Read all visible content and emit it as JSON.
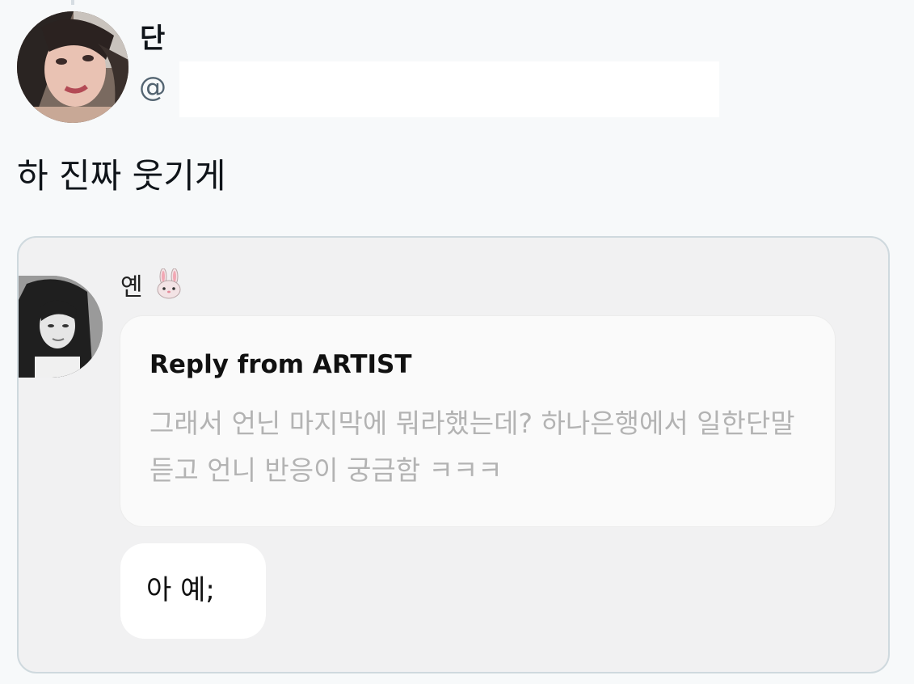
{
  "tweet": {
    "display_name": "단",
    "handle": "@",
    "text": "하 진짜 웃기게"
  },
  "quote": {
    "sender_name": "옌",
    "sender_emoji": "rabbit-face-icon",
    "reply_title": "Reply from ARTIST",
    "reply_text": "그래서 언닌 마지막에 뭐라했는데? 하나은행에서 일한단말듣고 언니 반응이 궁금함 ㅋㅋㅋ",
    "message": "아 예;"
  },
  "colors": {
    "page_bg": "#f7f9fa",
    "card_bg": "#f1f1f2",
    "card_border": "#cfd9de",
    "handle_gray": "#536471",
    "reply_gray": "#b3b3b3"
  }
}
